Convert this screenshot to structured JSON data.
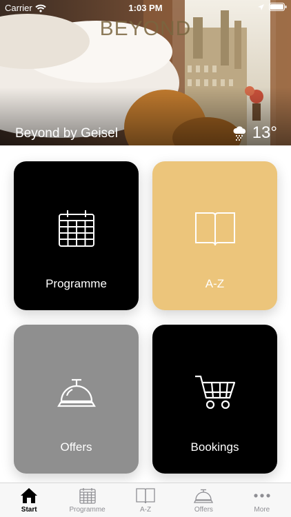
{
  "status_bar": {
    "carrier": "Carrier",
    "time": "1:03 PM",
    "icons": [
      "wifi-icon",
      "location-arrow-icon",
      "battery-icon"
    ]
  },
  "header": {
    "logo_text": "BEYOND",
    "hotel_name": "Beyond by Geisel",
    "weather": {
      "icon": "cloud-rain-icon",
      "temperature": "13°"
    }
  },
  "tiles": [
    {
      "label": "Programme",
      "icon": "calendar-icon",
      "color": "#000000"
    },
    {
      "label": "A-Z",
      "icon": "book-icon",
      "color": "#ECC57B"
    },
    {
      "label": "Offers",
      "icon": "service-bell-icon",
      "color": "#8F8F8F"
    },
    {
      "label": "Bookings",
      "icon": "shopping-cart-icon",
      "color": "#000000"
    }
  ],
  "tab_bar": {
    "active": "Start",
    "items": [
      {
        "label": "Start",
        "icon": "home-icon"
      },
      {
        "label": "Programme",
        "icon": "calendar-icon"
      },
      {
        "label": "A-Z",
        "icon": "book-icon"
      },
      {
        "label": "Offers",
        "icon": "service-bell-icon"
      },
      {
        "label": "More",
        "icon": "ellipsis-icon"
      }
    ]
  }
}
